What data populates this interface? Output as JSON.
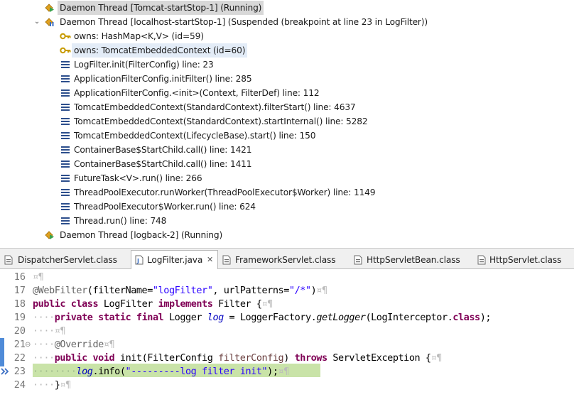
{
  "debug": {
    "threads": [
      {
        "label": "Daemon Thread [Tomcat-startStop-1] (Running)",
        "state": "running"
      },
      {
        "label": "Daemon Thread [localhost-startStop-1] (Suspended (breakpoint at line 23 in LogFilter))",
        "state": "suspended"
      },
      {
        "label": "Daemon Thread [logback-2] (Running)",
        "state": "running"
      }
    ],
    "monitors": [
      "owns: HashMap<K,V>  (id=59)",
      "owns: TomcatEmbeddedContext  (id=60)"
    ],
    "frames": [
      "LogFilter.init(FilterConfig) line: 23",
      "ApplicationFilterConfig.initFilter() line: 285",
      "ApplicationFilterConfig.<init>(Context, FilterDef) line: 112",
      "TomcatEmbeddedContext(StandardContext).filterStart() line: 4637",
      "TomcatEmbeddedContext(StandardContext).startInternal() line: 5282",
      "TomcatEmbeddedContext(LifecycleBase).start() line: 150",
      "ContainerBase$StartChild.call() line: 1421",
      "ContainerBase$StartChild.call() line: 1411",
      "FutureTask<V>.run() line: 266",
      "ThreadPoolExecutor.runWorker(ThreadPoolExecutor$Worker) line: 1149",
      "ThreadPoolExecutor$Worker.run() line: 624",
      "Thread.run() line: 748"
    ],
    "twisty_expanded": "⌄"
  },
  "tabs": [
    {
      "label": "DispatcherServlet.class",
      "active": false
    },
    {
      "label": "LogFilter.java",
      "active": true,
      "close": "✕"
    },
    {
      "label": "FrameworkServlet.class",
      "active": false
    },
    {
      "label": "HttpServletBean.class",
      "active": false
    },
    {
      "label": "HttpServlet.class",
      "active": false
    }
  ],
  "editor": {
    "line_numbers": [
      "16",
      "17",
      "18",
      "19",
      "20",
      "21",
      "22",
      "23",
      "24"
    ],
    "fold_marker": "⊖",
    "lines": {
      "l16": {
        "eol": "¤¶"
      },
      "l17": {
        "ann": "@WebFilter",
        "p1": "(filterName=",
        "s1": "\"logFilter\"",
        "p2": ", urlPatterns=",
        "s2": "\"/*\"",
        "p3": ")",
        "eol": "¤¶"
      },
      "l18": {
        "k1": "public",
        "k2": "class",
        "name": "LogFilter",
        "k3": "implements",
        "rest": "Filter {",
        "eol": "¤¶"
      },
      "l19": {
        "ws": "····",
        "k1": "private",
        "k2": "static",
        "k3": "final",
        "type": "Logger",
        "fld": "log",
        "eq": " = LoggerFactory.",
        "meth": "getLogger",
        "args": "(LogInterceptor.",
        "k4": "class",
        "end": ");"
      },
      "l20": {
        "ws": "····",
        "eol": "¤¶"
      },
      "l21": {
        "ws": "····",
        "ann": "@Override",
        "eol": "¤¶"
      },
      "l22": {
        "ws": "····",
        "k1": "public",
        "k2": "void",
        "sig1": "init(FilterConfig ",
        "param": "filterConfig",
        "sig2": ") ",
        "k3": "throws",
        "rest": "ServletException {",
        "eol": "¤¶"
      },
      "l23": {
        "ws": "········",
        "fld": "log",
        "call": ".info(",
        "str": "\"---------log filter init\"",
        "end": ");",
        "eol": "¤¶"
      },
      "l24": {
        "ws": "····",
        "rest": "}",
        "eol": "¤¶"
      }
    }
  },
  "colors": {
    "keyword": "#7f0055",
    "string": "#2a00ff",
    "field": "#0000c0",
    "annotation": "#646464",
    "current_line": "#c9e3a8"
  }
}
